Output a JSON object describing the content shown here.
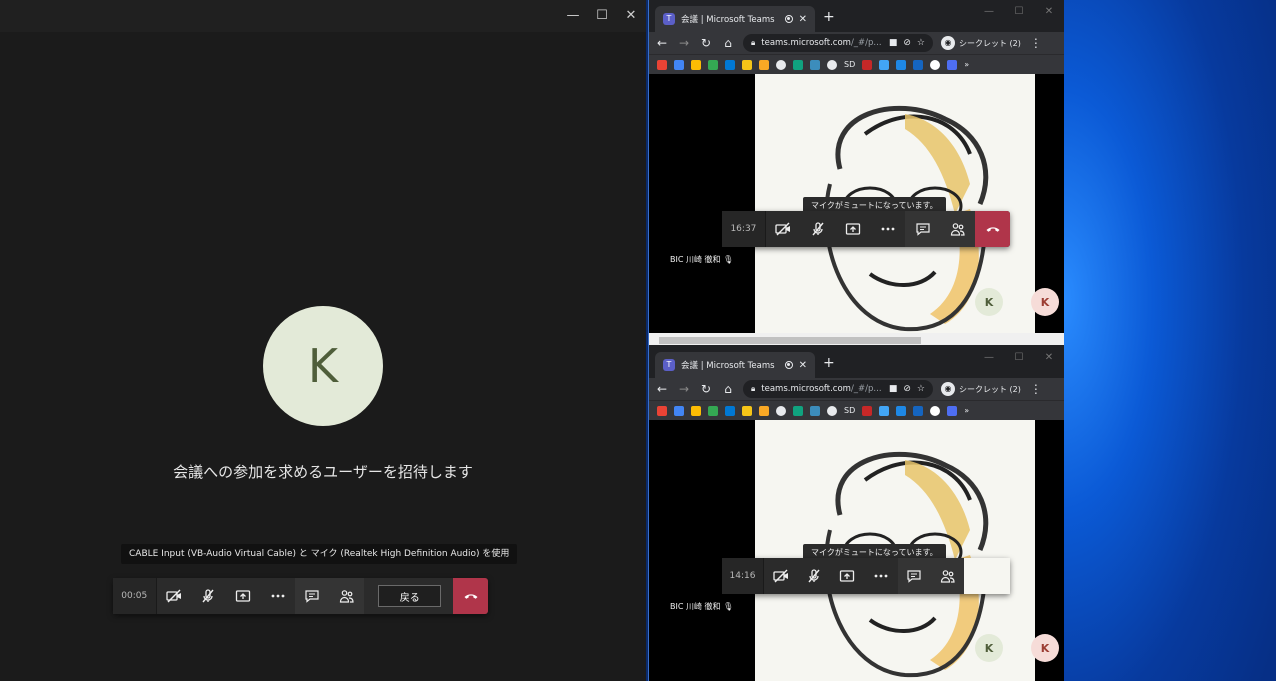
{
  "teams_app": {
    "window_controls": {
      "minimize": "—",
      "maximize": "☐",
      "close": "✕"
    },
    "avatar_initial": "K",
    "invite_text": "会議への参加を求めるユーザーを招待します",
    "device_tooltip": "CABLE Input (VB-Audio Virtual Cable) と マイク (Realtek High Definition Audio) を使用",
    "call_bar": {
      "timer": "00:05",
      "back_label": "戻る"
    }
  },
  "browser_top": {
    "tab_title": "会議 | Microsoft Teams",
    "url_host": "teams.microsoft.com",
    "url_path": "/_#/p...",
    "incognito_label": "シークレット (2)",
    "bookmark_text": "SD",
    "muted_tooltip": "マイクがミュートになっています。",
    "call_timer": "16:37",
    "participant_name": "BIC 川崎 徹和",
    "avatar_initial_green": "K",
    "avatar_initial_pink": "K"
  },
  "browser_bottom": {
    "tab_title": "会議 | Microsoft Teams",
    "url_host": "teams.microsoft.com",
    "url_path": "/_#/p...",
    "incognito_label": "シークレット (2)",
    "bookmark_text": "SD",
    "muted_tooltip": "マイクがミュートになっています。",
    "call_timer": "14:16",
    "participant_name": "BIC 川崎 徹和",
    "avatar_initial_green": "K",
    "avatar_initial_pink": "K"
  },
  "colors": {
    "hangup": "#b0354a",
    "teams_purple": "#5b5fc7",
    "desktop_blue": "#0b5ad6"
  }
}
